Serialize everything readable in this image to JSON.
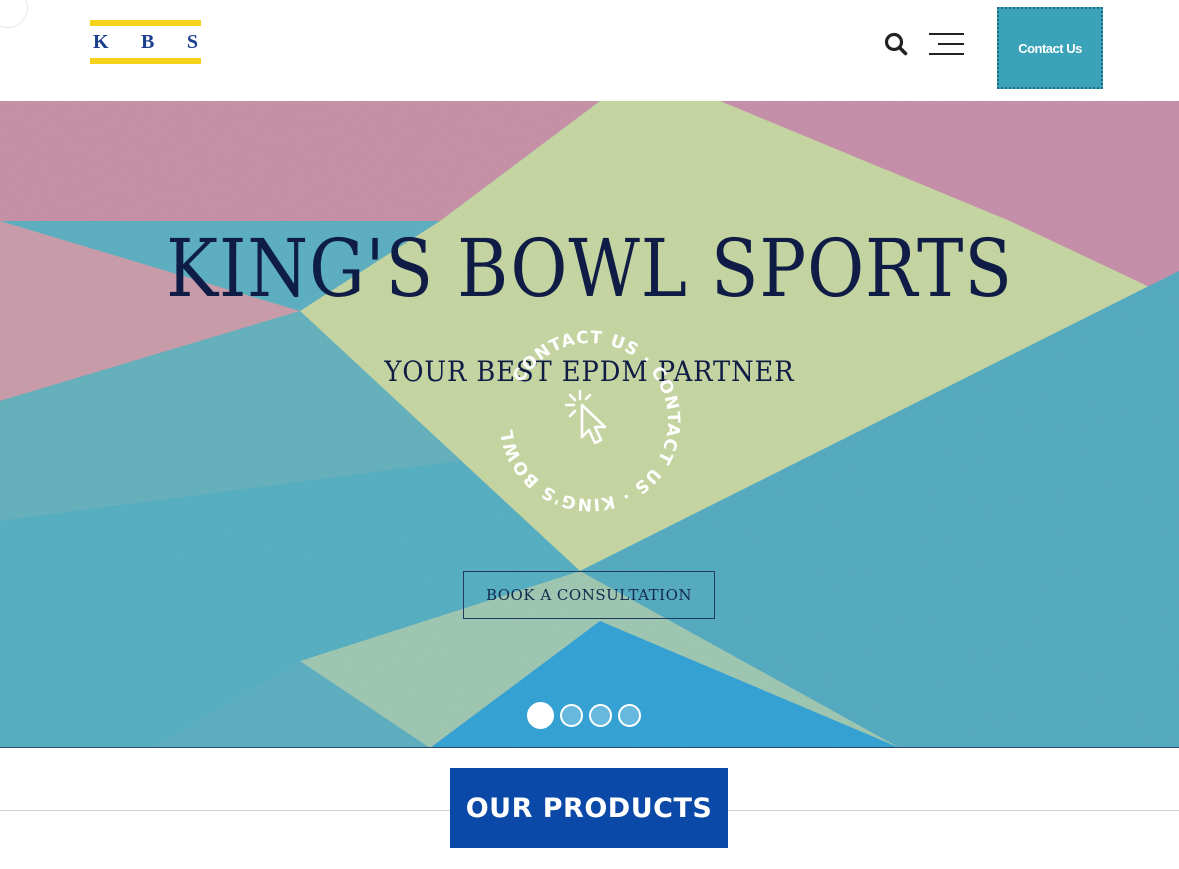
{
  "header": {
    "logo_letters": [
      "K",
      "B",
      "S"
    ],
    "contact_label": "Contact Us",
    "search_icon": "search-icon",
    "menu_icon": "hamburger-menu-icon"
  },
  "hero": {
    "title": "KING'S BOWL SPORTS",
    "subtitle": "YOUR BEST EPDM PARTNER",
    "badge_text": "CONTACT US · CONTACT US · KING'S BOWL SPORTS ·",
    "badge_icon": "pointer-click-icon",
    "cta_label": "BOOK A CONSULTATION",
    "slides": {
      "count": 4,
      "active_index": 0
    }
  },
  "products": {
    "heading": "OUR PRODUCTS"
  },
  "colors": {
    "logo_blue": "#1b3f8e",
    "logo_yellow": "#f4d21a",
    "contact_button": "#3aa2b9",
    "products_heading": "#0b49a8",
    "hero_text": "#0f1d46"
  }
}
